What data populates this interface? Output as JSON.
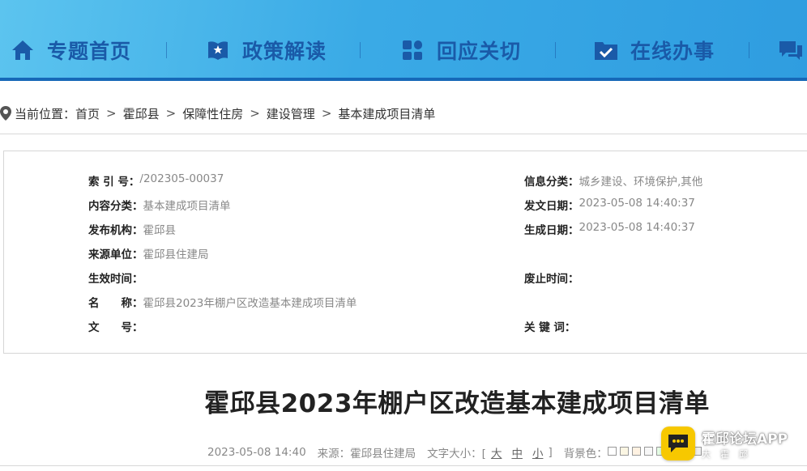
{
  "nav": {
    "items": [
      {
        "label": "专题首页",
        "icon": "home-icon"
      },
      {
        "label": "政策解读",
        "icon": "book-icon"
      },
      {
        "label": "回应关切",
        "icon": "grid-icon"
      },
      {
        "label": "在线办事",
        "icon": "checkbox-folder-icon"
      },
      {
        "label": "",
        "icon": "chat-icon"
      }
    ]
  },
  "breadcrumb": {
    "prefix": "当前位置：",
    "separator": ">",
    "items": [
      "首页",
      "霍邱县",
      "保障性住房",
      "建设管理",
      "基本建成项目清单"
    ]
  },
  "info": {
    "index_no": {
      "key": "索 引 号：",
      "value": "/202305-00037"
    },
    "info_category": {
      "key": "信息分类：",
      "value": "城乡建设、环境保护,其他"
    },
    "content_category": {
      "key": "内容分类：",
      "value": "基本建成项目清单"
    },
    "publish_date": {
      "key": "发文日期：",
      "value": "2023-05-08 14:40:37"
    },
    "publisher": {
      "key": "发布机构：",
      "value": "霍邱县"
    },
    "generate_date": {
      "key": "生成日期：",
      "value": "2023-05-08 14:40:37"
    },
    "source_unit": {
      "key": "来源单位：",
      "value": "霍邱县住建局"
    },
    "effective_time": {
      "key": "生效时间：",
      "value": ""
    },
    "expire_time": {
      "key": "废止时间：",
      "value": ""
    },
    "name": {
      "key": "名　　称：",
      "value": "霍邱县2023年棚户区改造基本建成项目清单"
    },
    "doc_no": {
      "key": "文　　号：",
      "value": ""
    },
    "keywords": {
      "key": "关 键 词：",
      "value": ""
    }
  },
  "article": {
    "title": "霍邱县2023年棚户区改造基本建成项目清单",
    "date": "2023-05-08 14:40",
    "source_label": "来源：",
    "source": "霍邱县住建局",
    "font_size_label": "文字大小：[",
    "font_sizes": [
      "大",
      "中",
      "小"
    ],
    "font_size_close": "]",
    "bg_label": "背景色：",
    "bg_colors": [
      "#ffffff",
      "#fbf6e3",
      "#fff2e2",
      "#f7f7f7",
      "#e6ffe6",
      "#e8f4ff",
      "#ffe8f0",
      "#eeeeee"
    ]
  },
  "watermark": {
    "app_name": "霍邱论坛APP",
    "slogan": "大霍邱"
  },
  "colors": {
    "nav_text": "#1a5aa8",
    "nav_border": "#1668b8",
    "badge_yellow": "#f7c800"
  }
}
